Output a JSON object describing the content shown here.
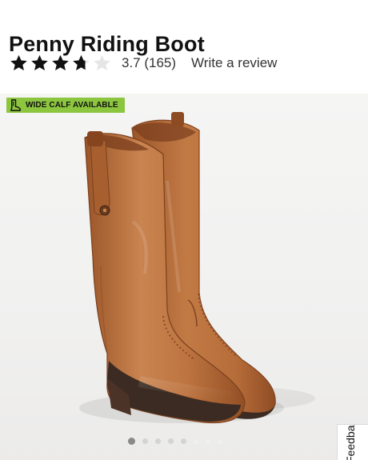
{
  "product": {
    "title": "Penny Riding Boot"
  },
  "rating": {
    "value": 3.7,
    "stars_max": 5,
    "summary": "3.7 (165)",
    "write_review_label": "Write a review",
    "star_color": "#111111",
    "empty_star_color": "#e6e6e6"
  },
  "gallery": {
    "badge_text": "WIDE CALF AVAILABLE",
    "badge_icon": "boot-icon",
    "badge_color": "#8cc63f",
    "image_name": "penny-riding-boot-image",
    "slide_count": 8,
    "active_slide": 1
  },
  "feedback": {
    "label": "Feedback"
  },
  "colors": {
    "leather": "#b86e3e",
    "sole": "#3b2b22",
    "background": "#f3f3f2"
  }
}
